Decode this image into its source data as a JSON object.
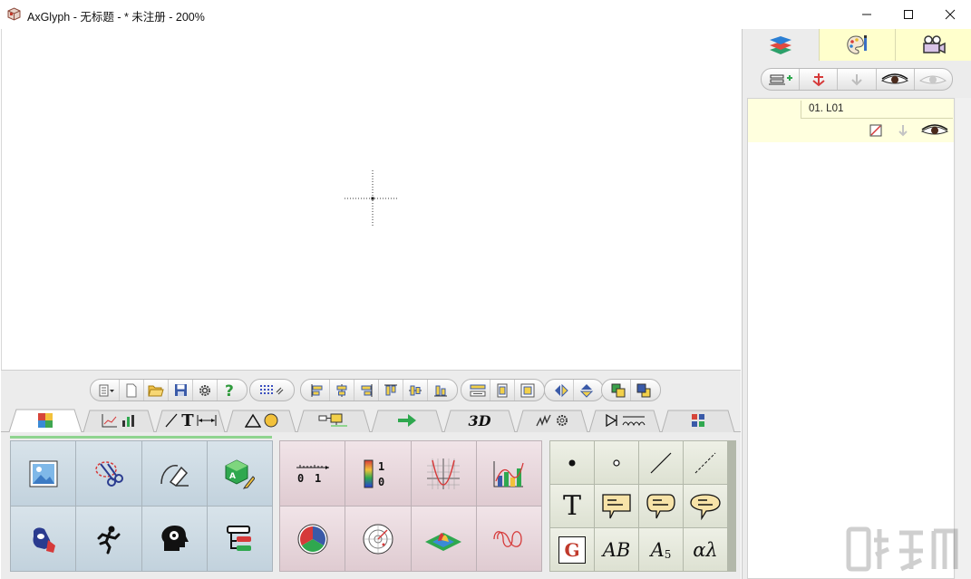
{
  "window": {
    "app_name": "AxGlyph",
    "title": "AxGlyph - 无标题 - * 未注册 - 200%",
    "controls": [
      "minimize",
      "maximize",
      "close"
    ]
  },
  "right_panel": {
    "tabs": [
      {
        "name": "layers-icon",
        "active": true
      },
      {
        "name": "palette-icon",
        "active": false
      },
      {
        "name": "video-camera-icon",
        "active": false
      }
    ],
    "layer_toolbar": [
      "add-layer-icon",
      "anchor-down-icon",
      "move-down-icon",
      "eye-open-icon",
      "eye-hidden-icon"
    ],
    "layers": [
      {
        "name": "01. L01"
      }
    ]
  },
  "toolbar_groups": [
    [
      "menu-dropdown-icon",
      "new-file-icon",
      "open-folder-icon",
      "save-icon",
      "settings-gear-icon",
      "help-icon"
    ],
    [
      "grid-snap-icon"
    ],
    [
      "align-left-icon",
      "align-center-h-icon",
      "align-right-icon",
      "align-top-icon",
      "align-center-v-icon",
      "align-bottom-icon"
    ],
    [
      "distribute-h-icon",
      "distribute-v-icon",
      "distribute-center-icon"
    ],
    [
      "flip-horizontal-icon",
      "flip-vertical-icon"
    ],
    [
      "bring-front-icon",
      "send-back-icon"
    ]
  ],
  "category_tabs": [
    {
      "name": "clipart-tab",
      "label": ""
    },
    {
      "name": "chart-tab",
      "label": ""
    },
    {
      "name": "line-text-tab",
      "label": "T"
    },
    {
      "name": "shapes-tab",
      "label": ""
    },
    {
      "name": "flowchart-tab",
      "label": ""
    },
    {
      "name": "arrow-tab",
      "label": ""
    },
    {
      "name": "3d-tab",
      "label": "3D"
    },
    {
      "name": "mechanics-tab",
      "label": ""
    },
    {
      "name": "circuit-tab",
      "label": ""
    },
    {
      "name": "misc-tab",
      "label": ""
    }
  ],
  "panels": {
    "clipart": [
      "image-icon",
      "scissors-icon",
      "pen-nib-icon",
      "cube-pencil-icon",
      "bag-icon",
      "running-man-icon",
      "brain-gear-icon",
      "tree-list-icon"
    ],
    "charts": {
      "items": [
        "number-line-icon",
        "color-bar-icon",
        "function-plot-icon",
        "area-chart-icon",
        "pie-chart-icon",
        "radar-icon",
        "surface-3d-icon",
        "spiral-icon"
      ],
      "number_line_labels": [
        "0",
        "1"
      ],
      "color_bar_labels": [
        "1",
        "0"
      ]
    },
    "text_shapes": {
      "items": [
        "dot-icon",
        "circle-point-icon",
        "line-icon",
        "dashed-line-icon",
        "text-T-icon",
        "callout-rect-icon",
        "callout-round-icon",
        "callout-oval-icon",
        "g-box-icon",
        "ab-text-icon",
        "a-sub-icon",
        "alpha-lambda-icon"
      ],
      "text_T": "T",
      "g_box": "G",
      "ab": "AB",
      "a_sub": "A",
      "a_sub_index": "5",
      "alpha_lambda": "αλ"
    }
  },
  "colors": {
    "accent_green": "#2fa84f",
    "layer_row": "#ffffde",
    "tab_yellow": "#ffffcc"
  }
}
